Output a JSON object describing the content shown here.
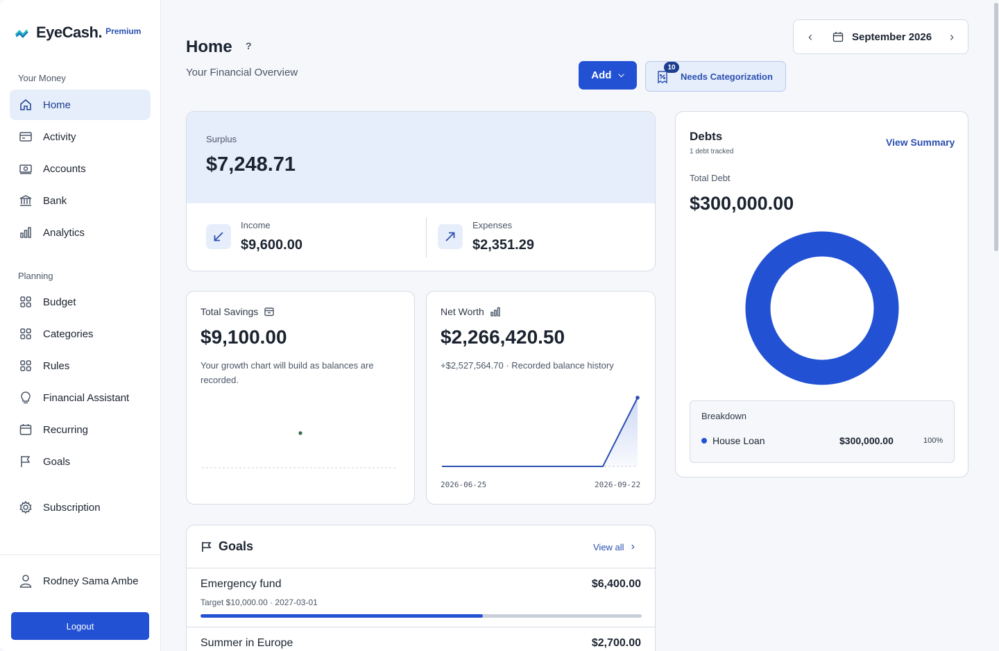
{
  "app": {
    "name": "EyeCash.",
    "badge": "Premium"
  },
  "sidebar": {
    "section_money": "Your Money",
    "section_planning": "Planning",
    "items": [
      {
        "label": "Home",
        "icon": "home-icon"
      },
      {
        "label": "Activity",
        "icon": "card-icon"
      },
      {
        "label": "Accounts",
        "icon": "cash-icon"
      },
      {
        "label": "Bank",
        "icon": "bank-icon"
      },
      {
        "label": "Analytics",
        "icon": "bar-chart-icon"
      },
      {
        "label": "Budget",
        "icon": "grid-icon"
      },
      {
        "label": "Categories",
        "icon": "grid-icon"
      },
      {
        "label": "Rules",
        "icon": "grid-icon"
      },
      {
        "label": "Financial Assistant",
        "icon": "lightbulb-icon"
      },
      {
        "label": "Recurring",
        "icon": "calendar-icon"
      },
      {
        "label": "Goals",
        "icon": "flag-icon"
      },
      {
        "label": "Subscription",
        "icon": "gear-icon"
      }
    ],
    "active": "Home",
    "user_name": "Rodney Sama Ambe",
    "logout_label": "Logout"
  },
  "header": {
    "title": "Home",
    "help": "?",
    "subtitle": "Your Financial Overview",
    "add_label": "Add",
    "needs_label": "Needs Categorization",
    "needs_count": "10",
    "month": "September 2026"
  },
  "surplus": {
    "label": "Surplus",
    "value": "$7,248.71",
    "income_label": "Income",
    "income_value": "$9,600.00",
    "expenses_label": "Expenses",
    "expenses_value": "$2,351.29"
  },
  "savings": {
    "label": "Total Savings",
    "value": "$9,100.00",
    "desc": "Your growth chart will build as balances are recorded."
  },
  "networth": {
    "label": "Net Worth",
    "value": "$2,266,420.50",
    "desc": "+$2,527,564.70 · Recorded balance history",
    "start_date": "2026-06-25",
    "end_date": "2026-09-22"
  },
  "debts": {
    "title": "Debts",
    "subtitle": "1 debt tracked",
    "view_summary": "View Summary",
    "total_label": "Total Debt",
    "total_value": "$300,000.00",
    "breakdown_title": "Breakdown",
    "items": [
      {
        "name": "House Loan",
        "amount": "$300,000.00",
        "pct": "100%",
        "fraction": 1.0,
        "color": "#2251d3"
      }
    ]
  },
  "goals": {
    "title": "Goals",
    "view_all": "View all",
    "items": [
      {
        "name": "Emergency fund",
        "amount": "$6,400.00",
        "meta": "Target $10,000.00 · 2027-03-01",
        "progress": 0.64
      },
      {
        "name": "Summer in Europe",
        "amount": "$2,700.00"
      }
    ]
  },
  "colors": {
    "accent": "#2251d3",
    "accent_dark": "#1c3e8f",
    "tint": "#e7eefb"
  }
}
